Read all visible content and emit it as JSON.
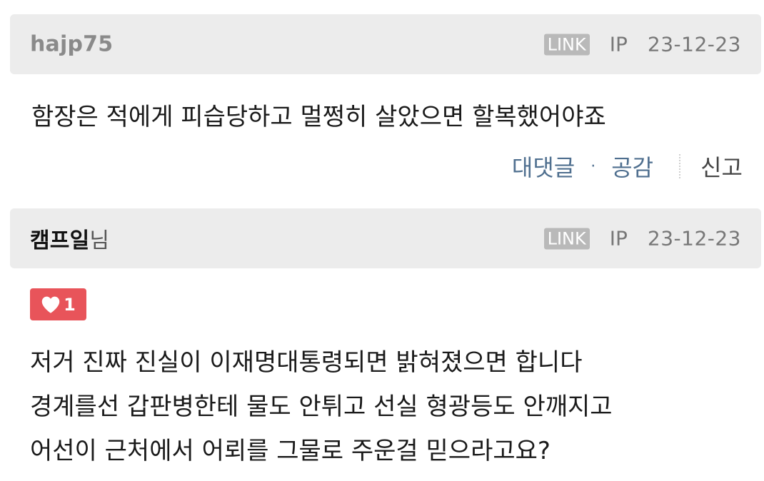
{
  "comments": [
    {
      "author": "hajp75",
      "author_suffix": "",
      "link_label": "LINK",
      "ip_label": "IP",
      "date": "23-12-23",
      "body": "함장은 적에게 피습당하고 멀쩡히 살았으면 할복했어야죠",
      "actions": {
        "reply": "대댓글",
        "like": "공감",
        "report": "신고"
      }
    },
    {
      "author": "캠프일",
      "author_suffix": "님",
      "link_label": "LINK",
      "ip_label": "IP",
      "date": "23-12-23",
      "likes": "1",
      "body_lines": [
        "저거 진짜 진실이 이재명대통령되면 밝혀졌으면 합니다",
        "경계를선 갑판병한테 물도 안튀고 선실 형광등도 안깨지고",
        "어선이 근처에서 어뢰를 그물로 주운걸 믿으라고요?"
      ]
    }
  ],
  "colors": {
    "header_bg": "#ececec",
    "link_badge_bg": "#b9b9b9",
    "like_badge_bg": "#e8545a",
    "action_link": "#4f6f8f"
  },
  "icons": {
    "like": "heart-icon"
  }
}
